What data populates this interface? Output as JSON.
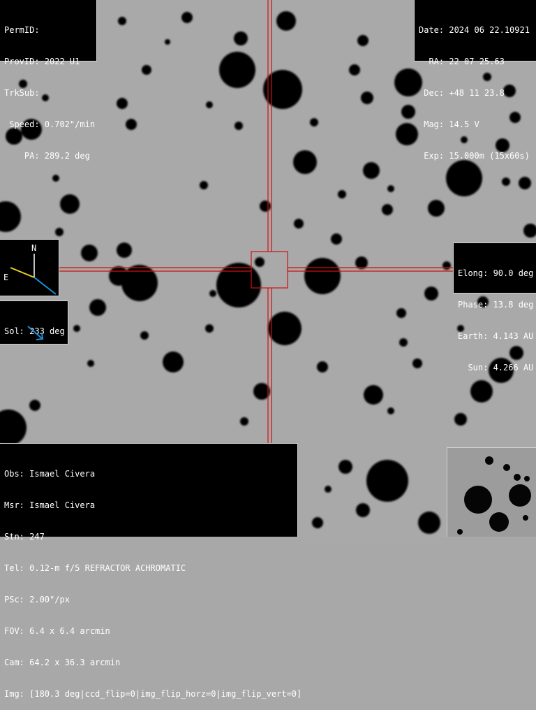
{
  "top_left": {
    "permid": "PermID:",
    "provid": "ProvID: 2022 U1",
    "trksub": "TrkSub:",
    "speed": " Speed: 0.702\"/min",
    "pa": "    PA: 289.2 deg"
  },
  "top_right": {
    "date": "Date: 2024 06 22.10921",
    "ra": "  RA: 22 07 25.63",
    "dec": " Dec: +48 11 23.8",
    "mag": " Mag: 14.5 V",
    "exp": " Exp: 15.000m (15x60s)"
  },
  "right": {
    "elong": "Elong: 90.0 deg",
    "phase": "Phase: 13.8 deg",
    "earth": "Earth: 4.143 AU",
    "sun": "  Sun: 4.266 AU"
  },
  "compass": {
    "north": "N",
    "east": "E"
  },
  "sol": {
    "label": "Sol: 233 deg"
  },
  "bottom_left": {
    "obs": "Obs: Ismael Civera",
    "msr": "Msr: Ismael Civera",
    "stn": "Stn: 247",
    "tel": "Tel: 0.12-m f/5 REFRACTOR ACHROMATIC",
    "psc": "PSc: 2.00\"/px",
    "fov": "FOV: 6.4 x 6.4 arcmin",
    "cam": "Cam: 64.2 x 36.3 arcmin",
    "img": "Img: [180.3 deg|ccd_flip=0|img_flip_horz=0|img_flip_vert=0]"
  },
  "colors": {
    "sky": "#a8a8a8",
    "crosshair": "#d01010",
    "compass_east": "#f0d020",
    "compass_motion": "#1a90d8",
    "sol_arrow": "#1a90d8"
  }
}
